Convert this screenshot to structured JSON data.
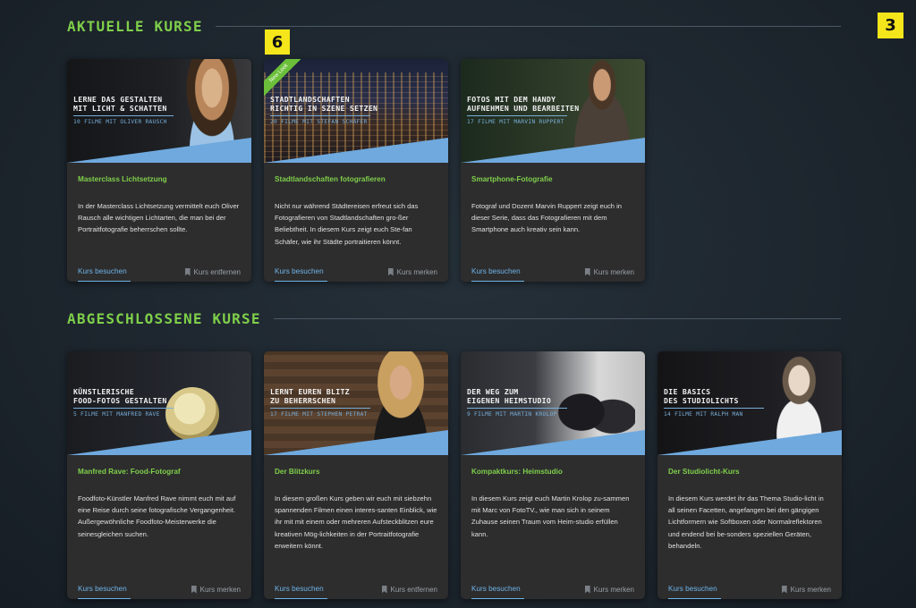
{
  "sections": {
    "current": {
      "title": "AKTUELLE KURSE"
    },
    "completed": {
      "title": "ABGESCHLOSSENE KURSE"
    }
  },
  "badges": {
    "top_right": "3",
    "card_marker": "6"
  },
  "colors": {
    "accent_green": "#7fcf4a",
    "link_blue": "#6fb3e6",
    "badge_yellow": "#f4e61a"
  },
  "cards": [
    {
      "thumb_title": "LERNE DAS GESTALTEN\nMIT LICHT & SCHATTEN",
      "thumb_sub": "10 FILME MIT OLIVER RAUSCH",
      "title": "Masterclass Lichtsetzung",
      "desc": "In der Masterclass Lichtsetzung vermittelt euch Oliver Rausch alle wichtigen Lichtarten, die man bei der Portraitfotografie beherrschen sollte.",
      "visit": "Kurs besuchen",
      "action": "Kurs entfernen"
    },
    {
      "ribbon": "New Look",
      "thumb_title": "STADTLANDSCHAFTEN\nRICHTIG IN SZENE SETZEN",
      "thumb_sub": "20 FILME MIT STEFAN SCHÄFER",
      "title": "Stadtlandschaften fotografieren",
      "desc": "Nicht nur während Städtereisen erfreut sich das Fotografieren von Stadtlandschaften gro-ßer Beliebtheit. In diesem Kurs zeigt euch Ste-fan Schäfer, wie ihr Städte portraitieren könnt.",
      "visit": "Kurs besuchen",
      "action": "Kurs merken"
    },
    {
      "thumb_title": "FOTOS MIT DEM HANDY\nAUFNEHMEN UND BEARBEITEN",
      "thumb_sub": "17 FILME MIT MARVIN RUPPERT",
      "title": "Smartphone-Fotografie",
      "desc": "Fotograf und Dozent Marvin Ruppert zeigt euch in dieser Serie, dass das Fotografieren mit dem Smartphone auch kreativ sein kann.",
      "visit": "Kurs besuchen",
      "action": "Kurs merken"
    },
    {
      "thumb_title": "KÜNSTLERISCHE\nFOOD-FOTOS GESTALTEN",
      "thumb_sub": "5 FILME MIT MANFRED RAVE",
      "title": "Manfred Rave: Food-Fotograf",
      "desc": "Foodfoto-Künstler Manfred Rave nimmt euch mit auf eine Reise durch seine fotografische Vergangenheit. Außergewöhnliche Foodfoto-Meisterwerke die seinesgleichen suchen.",
      "visit": "Kurs besuchen",
      "action": "Kurs merken"
    },
    {
      "thumb_title": "LERNT EUREN BLITZ\nZU BEHERRSCHEN",
      "thumb_sub": "17 FILME MIT STEPHEN PETRAT",
      "title": "Der Blitzkurs",
      "desc": "In diesem großen Kurs geben wir euch mit siebzehn spannenden Filmen einen interes-santen Einblick, wie ihr mit mit einem oder mehreren Aufsteckblitzen eure kreativen Mög-lichkeiten in der Portraitfotografie erweitern könnt.",
      "visit": "Kurs besuchen",
      "action": "Kurs entfernen"
    },
    {
      "thumb_title": "DER WEG ZUM\nEIGENEN HEIMSTUDIO",
      "thumb_sub": "9 FILME MIT MARTIN KROLOP",
      "title": "Kompaktkurs: Heimstudio",
      "desc": "In diesem Kurs zeigt euch Martin Krolop zu-sammen mit Marc von FotoTV., wie man sich in seinem Zuhause seinen Traum vom Heim-studio erfüllen kann.",
      "visit": "Kurs besuchen",
      "action": "Kurs merken"
    },
    {
      "thumb_title": "DIE BASICS\nDES STUDIOLICHTS",
      "thumb_sub": "14 FILME MIT RALPH MAN",
      "title": "Der Studiolicht-Kurs",
      "desc": "In diesem Kurs werdet ihr das Thema Studio-licht in all seinen Facetten, angefangen bei den gängigen Lichtformern wie Softboxen oder Normalreflektoren und endend bei be-sonders speziellen Geräten, behandeln.",
      "visit": "Kurs besuchen",
      "action": "Kurs merken"
    }
  ]
}
